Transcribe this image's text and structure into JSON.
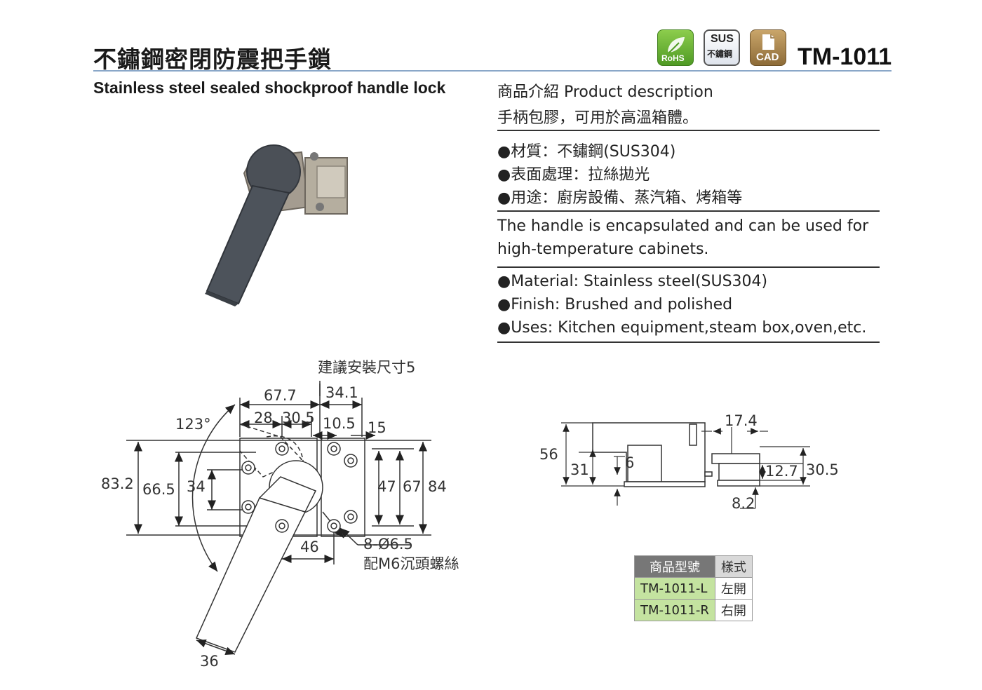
{
  "header": {
    "title_zh": "不鏽鋼密閉防震把手鎖",
    "title_en": "Stainless steel sealed shockproof handle lock",
    "model": "TM-1011",
    "badges": {
      "rohs": "RoHS",
      "sus_top": "SUS",
      "sus_bottom": "不鏽鋼",
      "cad": "CAD"
    }
  },
  "description": {
    "heading": "商品介紹 Product description",
    "zh_text": "手柄包膠，可用於高溫箱體。",
    "zh_bullets": [
      "●材質：不鏽鋼(SUS304)",
      "●表面處理：拉絲拋光",
      "●用途：廚房設備、蒸汽箱、烤箱等"
    ],
    "en_text_line1": "The handle is encapsulated and can be used for",
    "en_text_line2": "high-temperature cabinets.",
    "en_bullets": [
      "●Material: Stainless steel(SUS304)",
      "●Finish: Brushed and polished",
      "●Uses: Kitchen equipment,steam box,oven,etc."
    ]
  },
  "drawing_front": {
    "install_note": "建議安裝尺寸5",
    "dims": {
      "d67_7": "67.7",
      "d34_1": "34.1",
      "d28": "28",
      "d30_5": "30.5",
      "d10_5": "10.5",
      "d15": "15",
      "angle": "123°",
      "d83_2": "83.2",
      "d66_5": "66.5",
      "d34": "34",
      "d47": "47",
      "d67": "67",
      "d84": "84",
      "d46": "46",
      "d36": "36"
    },
    "hole_note_1": "8-Ø6.5",
    "hole_note_2": "配M6沉頭螺絲"
  },
  "drawing_side": {
    "dims": {
      "d56": "56",
      "d31": "31",
      "d6": "6",
      "d17_4": "17.4",
      "d12_7": "12.7",
      "d30_5": "30.5",
      "d8_2": "8.2"
    }
  },
  "model_table": {
    "headers": [
      "商品型號",
      "樣式"
    ],
    "rows": [
      {
        "code": "TM-1011-L",
        "style": "左開"
      },
      {
        "code": "TM-1011-R",
        "style": "右開"
      }
    ]
  }
}
